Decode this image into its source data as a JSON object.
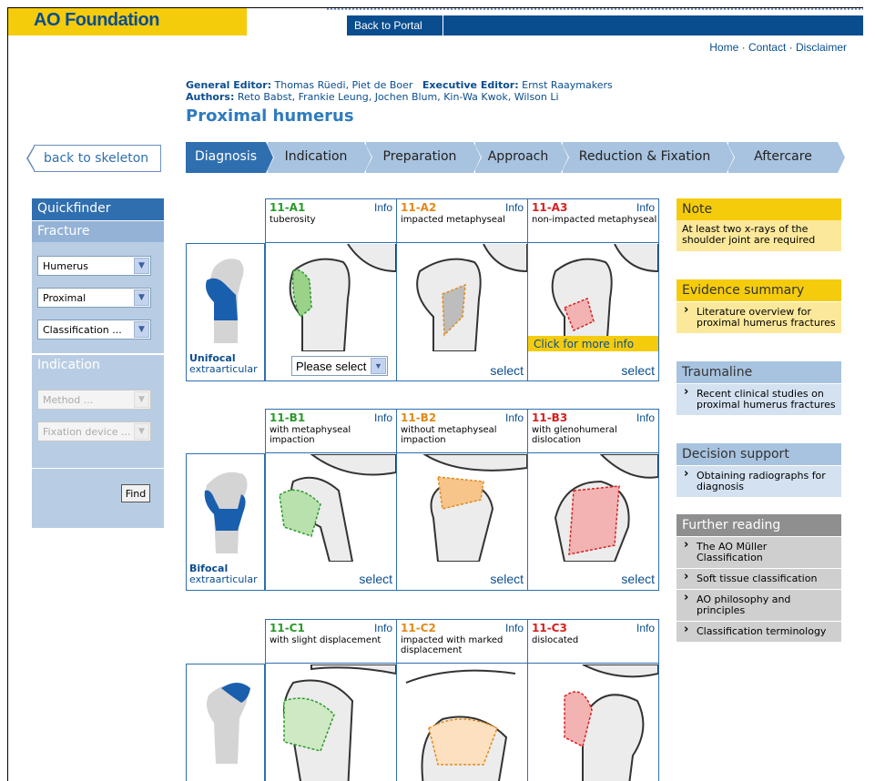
{
  "header": {
    "logo_ao": "AO",
    "logo_foundation": "Foundation",
    "portal": "Back to Portal",
    "links": [
      "Home",
      "Contact",
      "Disclaimer"
    ]
  },
  "editors": {
    "general_label": "General Editor:",
    "general": "Thomas Rüedi, Piet de Boer",
    "exec_label": "Executive Editor:",
    "exec": "Ernst Raaymakers",
    "authors_label": "Authors:",
    "authors": "Reto Babst, Frankie Leung, Jochen Blum, Kin-Wa Kwok, Wilson Li"
  },
  "page_title": "Proximal humerus",
  "back_skeleton": "back to skeleton",
  "steps": [
    "Diagnosis",
    "Indication",
    "Preparation",
    "Approach",
    "Reduction & Fixation",
    "Aftercare"
  ],
  "quickfinder": {
    "title": "Quickfinder",
    "fracture": "Fracture",
    "sel1": "Humerus",
    "sel2": "Proximal",
    "sel3": "Classification ...",
    "indication": "Indication",
    "sel4": "Method ...",
    "sel5": "Fixation device ...",
    "find": "Find"
  },
  "grid": {
    "info": "Info",
    "select": "select",
    "please_select": "Please select",
    "more_info": "Click for more info",
    "rows": [
      {
        "label_bold": "Unifocal",
        "label": "extraarticular",
        "cells": [
          {
            "code": "11-A1",
            "desc": "tuberosity"
          },
          {
            "code": "11-A2",
            "desc": "impacted metaphyseal"
          },
          {
            "code": "11-A3",
            "desc": "non-impacted metaphyseal"
          }
        ]
      },
      {
        "label_bold": "Bifocal",
        "label": "extraarticular",
        "cells": [
          {
            "code": "11-B1",
            "desc": "with metaphyseal impaction"
          },
          {
            "code": "11-B2",
            "desc": "without metaphyseal impaction"
          },
          {
            "code": "11-B3",
            "desc": "with glenohumeral dislocation"
          }
        ]
      },
      {
        "label_bold": "",
        "label": "",
        "cells": [
          {
            "code": "11-C1",
            "desc": "with slight displacement"
          },
          {
            "code": "11-C2",
            "desc": "impacted with marked displacement"
          },
          {
            "code": "11-C3",
            "desc": "dislocated"
          }
        ]
      }
    ]
  },
  "panels": {
    "note_title": "Note",
    "note_text": "At least two x-rays of the shoulder joint are required",
    "evidence_title": "Evidence summary",
    "evidence_item": "Literature overview for proximal humerus fractures",
    "trauma_title": "Traumaline",
    "trauma_item": "Recent clinical studies on proximal humerus fractures",
    "decision_title": "Decision support",
    "decision_item": "Obtaining radiographs for diagnosis",
    "further_title": "Further reading",
    "further_items": [
      "The AO Müller Classification",
      "Soft tissue classification",
      "AO philosophy and principles",
      "Classification terminology"
    ]
  },
  "colors": {
    "brand_blue": "#0a4d8f",
    "brand_yellow": "#f5cc0c",
    "green": "#2a9a2a",
    "orange": "#e08a1a",
    "red": "#d62020"
  }
}
